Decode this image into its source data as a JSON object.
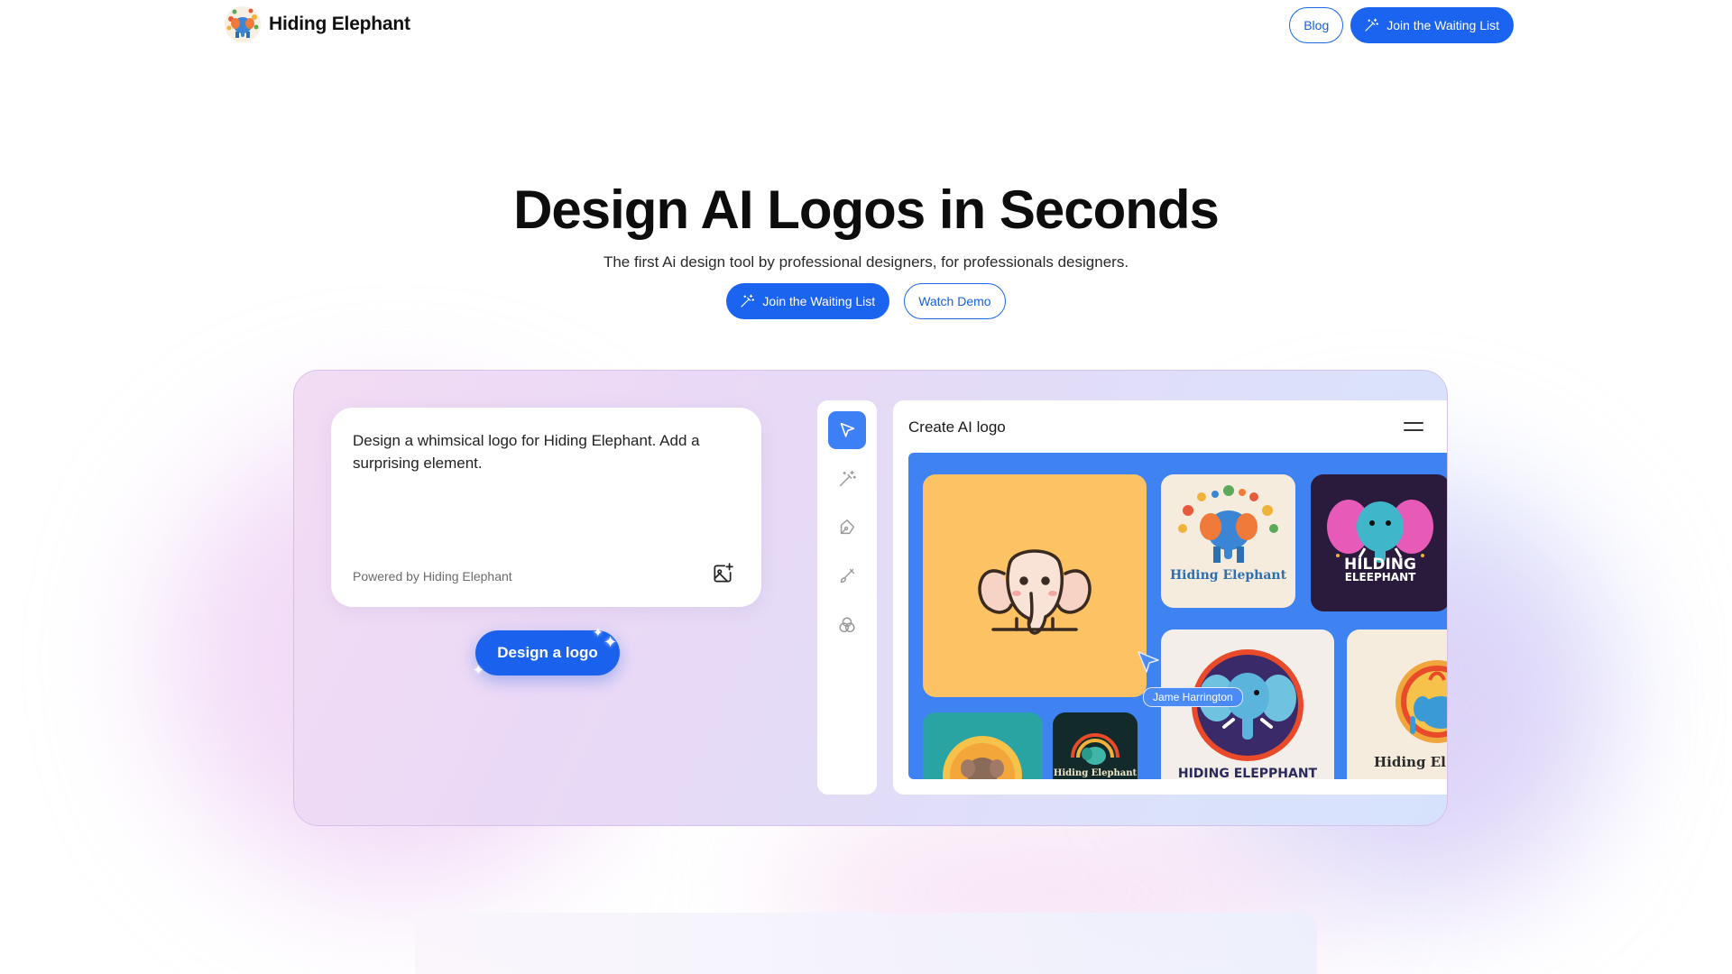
{
  "brand": {
    "name": "Hiding Elephant"
  },
  "nav": {
    "blog_label": "Blog",
    "join_label": "Join the Waiting List"
  },
  "hero": {
    "title": "Design AI Logos in Seconds",
    "subtitle": "The first Ai design tool by professional designers, for professionals designers.",
    "primary_cta": "Join the Waiting List",
    "secondary_cta": "Watch Demo"
  },
  "prompt": {
    "text": "Design a whimsical logo for Hiding Elephant. Add a surprising element.",
    "powered_by": "Powered by Hiding Elephant",
    "button_label": "Design a logo"
  },
  "toolbar": {
    "tools": [
      "select-tool",
      "magic-wand-tool",
      "pen-tool",
      "brush-tool",
      "blend-tool"
    ]
  },
  "panel": {
    "title": "Create AI logo",
    "cursor_user": "Jame Harrington",
    "tiles": {
      "t2_label": "Hiding Elephant",
      "t3_label_1": "HILDING",
      "t3_label_2": "ELEEPHANT",
      "t4_label": "HIDING ELEPPHANT",
      "t5_label": "Hiding El",
      "t7_label": "Hiding Elephant"
    }
  },
  "colors": {
    "accent": "#1a64f0",
    "gallery_bg": "#3f83f2",
    "orange_tile": "#fcc263"
  }
}
